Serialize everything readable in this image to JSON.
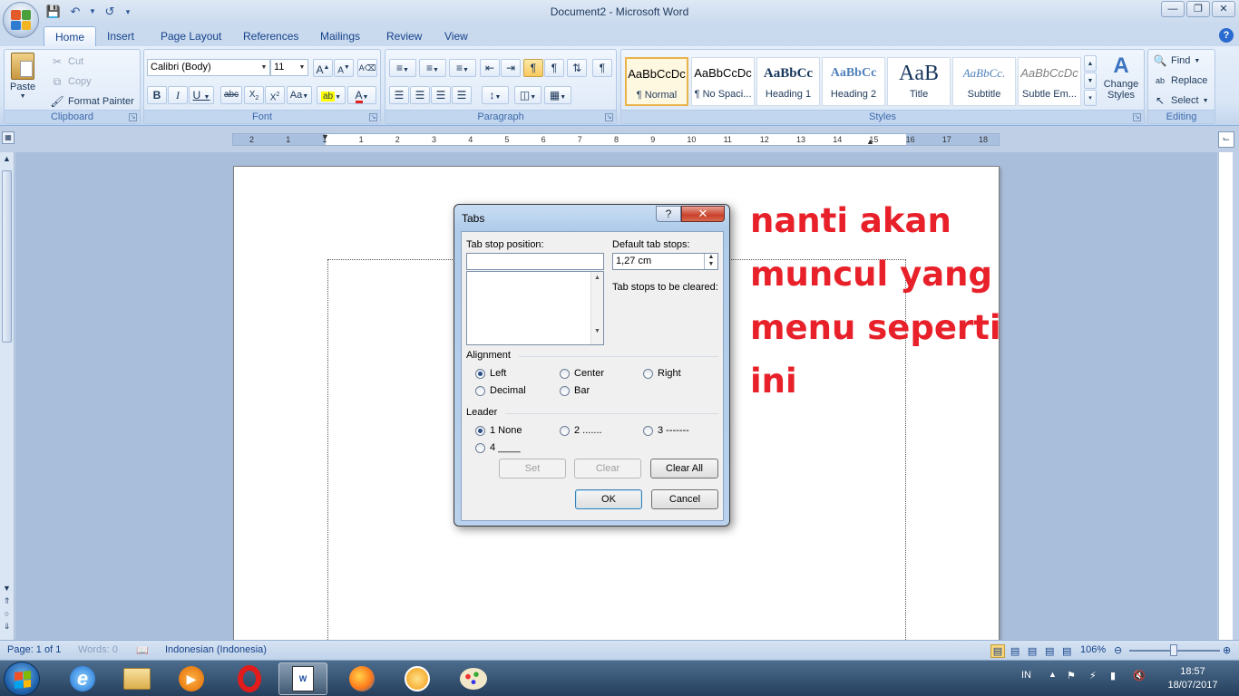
{
  "window": {
    "title": "Document2 - Microsoft Word"
  },
  "tabs": [
    "Home",
    "Insert",
    "Page Layout",
    "References",
    "Mailings",
    "Review",
    "View"
  ],
  "clipboard": {
    "paste": "Paste",
    "cut": "Cut",
    "copy": "Copy",
    "format_painter": "Format Painter",
    "label": "Clipboard"
  },
  "font": {
    "name": "Calibri (Body)",
    "size": "11",
    "label": "Font"
  },
  "paragraph": {
    "label": "Paragraph"
  },
  "styles": {
    "label": "Styles",
    "items": [
      {
        "preview": "AaBbCcDc",
        "name": "¶ Normal"
      },
      {
        "preview": "AaBbCcDc",
        "name": "¶ No Spaci..."
      },
      {
        "preview": "AaBbCc",
        "name": "Heading 1"
      },
      {
        "preview": "AaBbCc",
        "name": "Heading 2"
      },
      {
        "preview": "AaB",
        "name": "Title"
      },
      {
        "preview": "AaBbCc.",
        "name": "Subtitle"
      },
      {
        "preview": "AaBbCcDc",
        "name": "Subtle Em..."
      }
    ],
    "change_styles": "Change Styles"
  },
  "editing": {
    "find": "Find",
    "replace": "Replace",
    "select": "Select",
    "label": "Editing"
  },
  "ruler": {
    "numbers": [
      "2",
      "1",
      "1",
      "1",
      "2",
      "3",
      "4",
      "5",
      "6",
      "7",
      "8",
      "9",
      "10",
      "11",
      "12",
      "13",
      "14",
      "15",
      "16",
      "17",
      "18"
    ]
  },
  "annotation": {
    "text": "nanti akan muncul yang menu seperti ini"
  },
  "dialog": {
    "title": "Tabs",
    "help": "?",
    "close": "✕",
    "tab_stop_position_label": "Tab stop position:",
    "tab_stop_position_value": "",
    "default_tab_stops_label": "Default tab stops:",
    "default_tab_stops_value": "1,27 cm",
    "to_be_cleared_label": "Tab stops to be cleared:",
    "alignment_label": "Alignment",
    "alignment": {
      "left": "Left",
      "center": "Center",
      "right": "Right",
      "decimal": "Decimal",
      "bar": "Bar",
      "selected": "Left"
    },
    "leader_label": "Leader",
    "leader": {
      "none": "1 None",
      "dots": "2 .......",
      "dashes": "3 -------",
      "line": "4 ____",
      "selected": "1 None"
    },
    "set_button": "Set",
    "clear_button": "Clear",
    "clear_all_button": "Clear All",
    "ok_button": "OK",
    "cancel_button": "Cancel"
  },
  "status": {
    "page": "Page: 1 of 1",
    "words": "Words: 0",
    "language": "Indonesian (Indonesia)",
    "zoom": "106%"
  },
  "taskbar": {
    "input_lang": "IN",
    "time": "18:57",
    "date": "18/07/2017"
  }
}
